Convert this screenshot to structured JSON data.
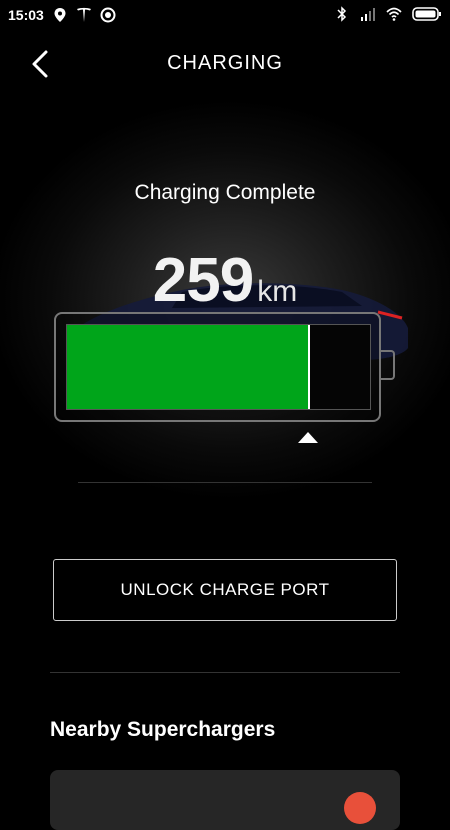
{
  "status_bar": {
    "time": "15:03",
    "left_icons": [
      "location-pin-icon",
      "tesla-logo-icon",
      "chat-bubble-icon"
    ],
    "right_icons": [
      "bluetooth-icon",
      "signal-icon",
      "wifi-icon",
      "battery-icon"
    ]
  },
  "header": {
    "title": "CHARGING",
    "back_icon": "chevron-left-icon"
  },
  "charging": {
    "status": "Charging Complete",
    "range_value": "259",
    "range_unit": "km",
    "battery_level_fraction": 0.8,
    "charge_limit_fraction": 0.8,
    "fill_color": "#00a51a"
  },
  "actions": {
    "unlock_label": "UNLOCK CHARGE PORT"
  },
  "superchargers": {
    "title": "Nearby Superchargers"
  }
}
